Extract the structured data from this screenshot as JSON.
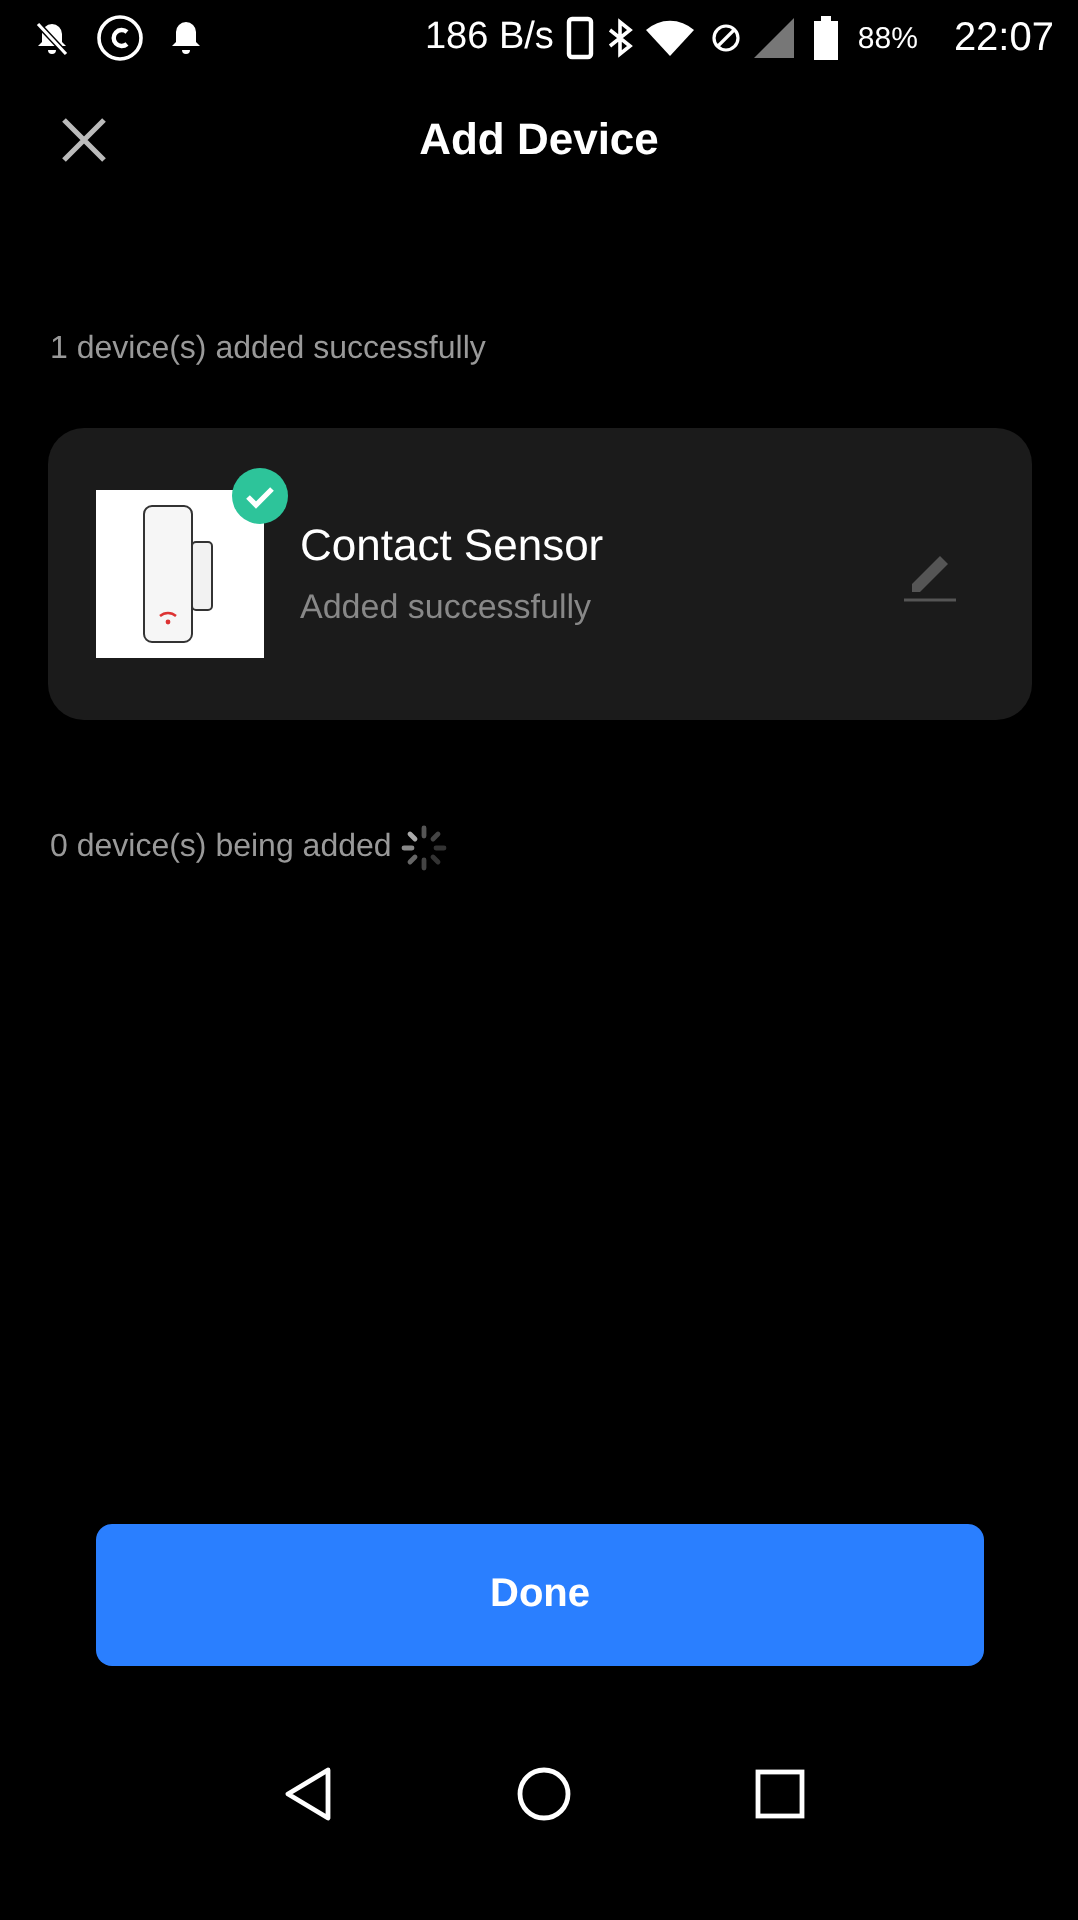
{
  "status_bar": {
    "network_speed": "186 B/s",
    "battery_percent": "88%",
    "time": "22:07"
  },
  "header": {
    "title": "Add Device"
  },
  "added_section": {
    "label": "1 device(s) added successfully",
    "devices": [
      {
        "name": "Contact Sensor",
        "status": "Added successfully",
        "added": true
      }
    ]
  },
  "pending_section": {
    "label": "0 device(s) being added",
    "loading": true
  },
  "done_button": {
    "label": "Done"
  }
}
